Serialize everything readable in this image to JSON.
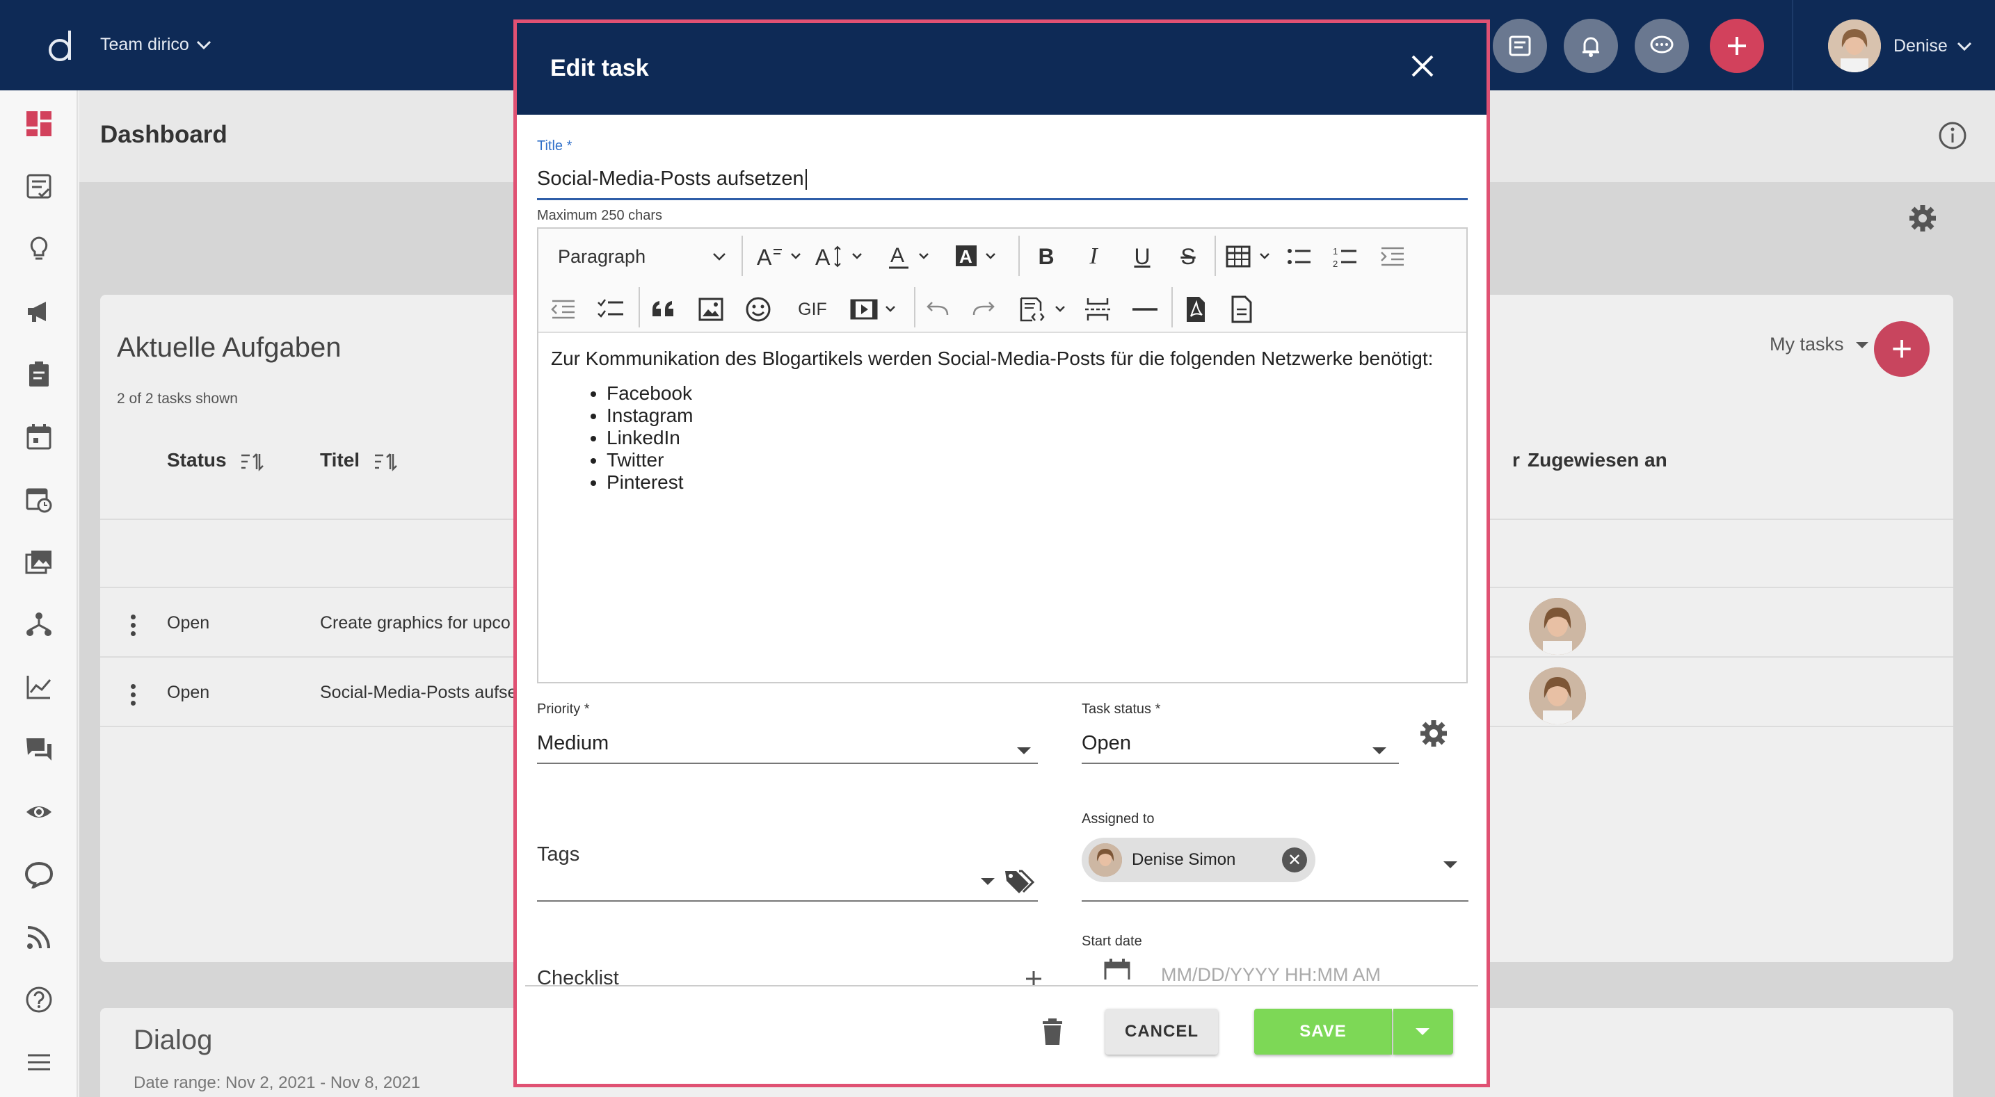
{
  "topbar": {
    "team": "Team dirico",
    "user_name": "Denise"
  },
  "dashboard": {
    "title": "Dashboard"
  },
  "tasks_card": {
    "title": "Aktuelle Aufgaben",
    "subtitle": "2 of 2 tasks shown",
    "filter": "My tasks",
    "columns": {
      "status": "Status",
      "title": "Titel",
      "partial": "r",
      "assigned": "Zugewiesen an"
    },
    "rows": [
      {
        "status": "Open",
        "title": "Create graphics for upco"
      },
      {
        "status": "Open",
        "title": "Social-Media-Posts aufse"
      }
    ]
  },
  "dialog_card": {
    "title": "Dialog",
    "date_range": "Date range: Nov 2, 2021 - Nov 8, 2021"
  },
  "modal": {
    "title": "Edit task",
    "title_label": "Title *",
    "title_value": "Social-Media-Posts aufsetzen",
    "title_hint": "Maximum 250 chars",
    "editor": {
      "paragraph_select": "Paragraph",
      "gif_label": "GIF",
      "intro": "Zur Kommunikation des Blogartikels werden Social-Media-Posts für die folgenden Netzwerke benötigt:",
      "bullets": [
        "Facebook",
        "Instagram",
        "LinkedIn",
        "Twitter",
        "Pinterest"
      ]
    },
    "priority_label": "Priority *",
    "priority_value": "Medium",
    "status_label": "Task status *",
    "status_value": "Open",
    "tags_label": "Tags",
    "assigned_label": "Assigned to",
    "assigned_chip": "Denise Simon",
    "checklist_label": "Checklist",
    "start_date_label": "Start date",
    "start_date_placeholder": "MM/DD/YYYY HH:MM AM",
    "cancel": "CANCEL",
    "save": "SAVE"
  }
}
